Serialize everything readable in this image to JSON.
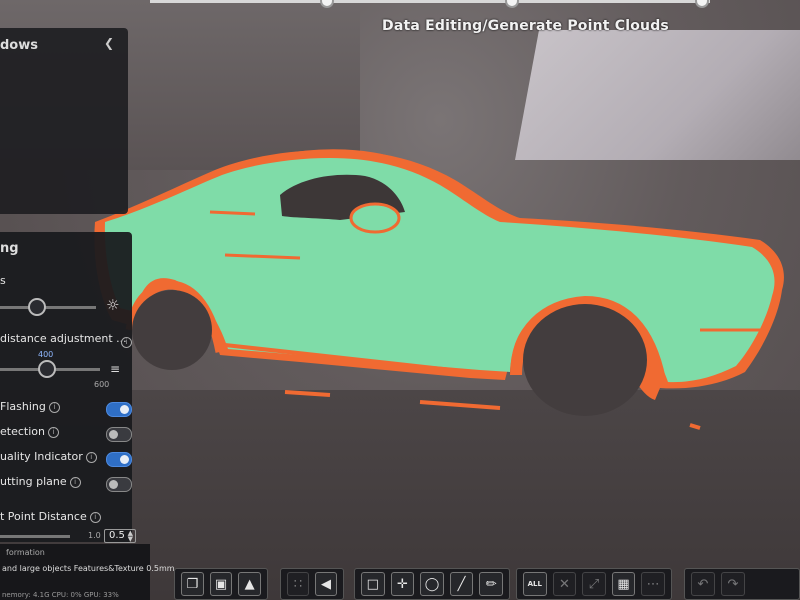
{
  "top_bar": {
    "status_title": "Data Editing/Generate Point Clouds"
  },
  "windows_panel": {
    "title": "dows",
    "chevron_icon": "chevron-down-icon"
  },
  "settings_panel": {
    "title": "ng",
    "brightness_label": "s",
    "brightness_level": 0.36,
    "distance_label": "distance adjustment ...",
    "distance_value": "400",
    "distance_max": "600",
    "flashing_label": "Flashing",
    "flashing_on": true,
    "detection_label": "etection",
    "detection_on": false,
    "quality_label": "uality Indicator",
    "quality_on": true,
    "cutting_label": "utting plane",
    "cutting_on": false,
    "point_distance_label": "t Point Distance",
    "point_distance_min": "1.0",
    "point_distance_value": "0.5"
  },
  "bottom_info": {
    "header": "formation",
    "line": "and large objects   Features&Texture   0.5mm",
    "footer": "nemory: 4.1G CPU: 0% GPU: 33%"
  },
  "toolbar": {
    "all_label": "ALL"
  },
  "colors": {
    "scan_green": "#7fdca8",
    "scan_orange": "#f06a32",
    "toggle_on": "#2f6fc6"
  }
}
